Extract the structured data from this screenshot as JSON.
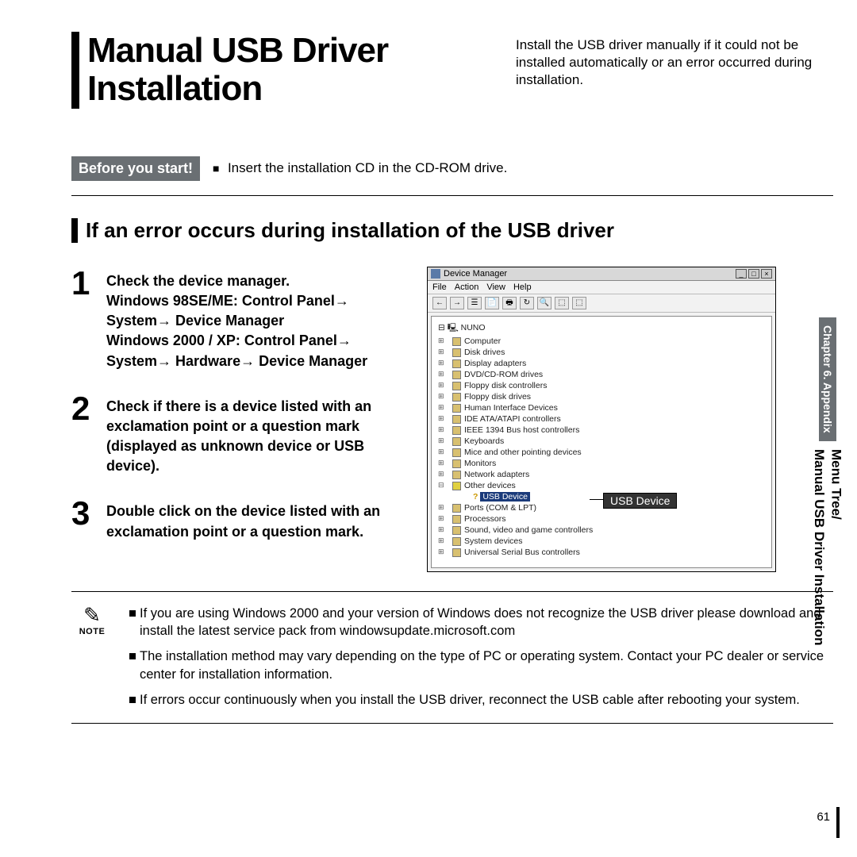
{
  "header": {
    "title": "Manual USB Driver Installation",
    "subtitle": "Install the USB driver manually if it could not be installed automatically or an error occurred during installation."
  },
  "before": {
    "badge": "Before you start!",
    "text": "Insert the installation CD in the CD-ROM drive."
  },
  "section_heading": "If an error occurs during installation of the USB driver",
  "steps": [
    {
      "num": "1",
      "text": "Check the device manager.\nWindows 98SE/ME: Control Panel→ System→ Device Manager\nWindows 2000 / XP: Control Panel→ System→ Hardware→ Device Manager"
    },
    {
      "num": "2",
      "text": "Check if there is a device listed with an exclamation point or a question mark (displayed as unknown device or USB device)."
    },
    {
      "num": "3",
      "text": "Double click on the device listed with an exclamation point or a question mark."
    }
  ],
  "device_manager": {
    "window_title": "Device Manager",
    "menus": [
      "File",
      "Action",
      "View",
      "Help"
    ],
    "root": "NUNO",
    "items": [
      "Computer",
      "Disk drives",
      "Display adapters",
      "DVD/CD-ROM drives",
      "Floppy disk controllers",
      "Floppy disk drives",
      "Human Interface Devices",
      "IDE ATA/ATAPI controllers",
      "IEEE 1394 Bus host controllers",
      "Keyboards",
      "Mice and other pointing devices",
      "Monitors",
      "Network adapters"
    ],
    "other_label": "Other devices",
    "selected": "USB Device",
    "callout": "USB Device",
    "items_after": [
      "Ports (COM & LPT)",
      "Processors",
      "Sound, video and game controllers",
      "System devices",
      "Universal Serial Bus controllers"
    ]
  },
  "note": {
    "label": "NOTE",
    "items": [
      "If you are using Windows 2000 and your version of Windows does not recognize the USB driver please download and install the latest service pack from windowsupdate.microsoft.com",
      "The installation method may vary depending on the type of PC or operating system. Contact your PC dealer or service center for installation information.",
      "If errors occur continuously when you install the USB driver, reconnect the USB cable after rebooting your system."
    ]
  },
  "sidebar": {
    "chapter": "Chapter 6. Appendix",
    "section_line1": "Menu Tree/",
    "section_line2": "Manual USB Driver Installation"
  },
  "page_number": "61"
}
